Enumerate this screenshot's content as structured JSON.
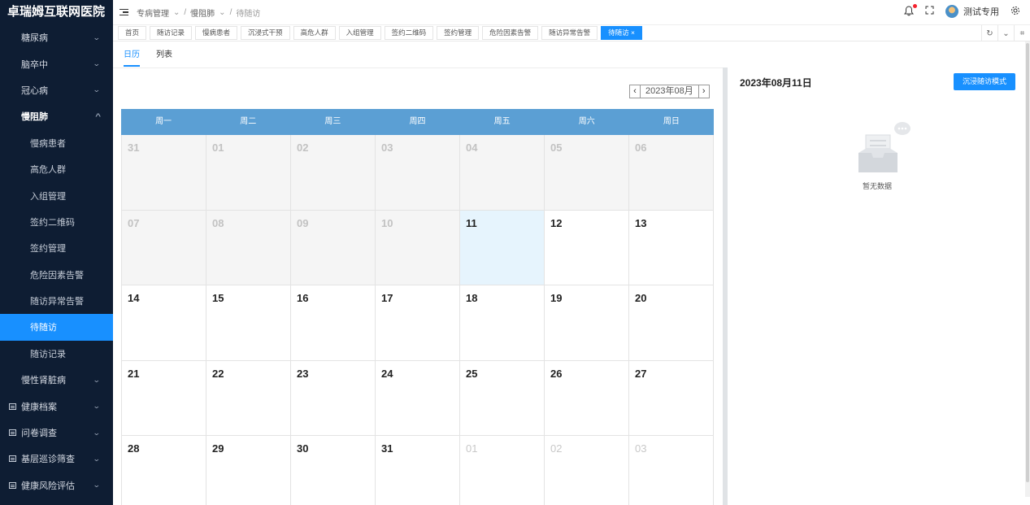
{
  "app": {
    "title": "卓瑞姆互联网医院"
  },
  "sidebar": {
    "items": [
      {
        "label": "糖尿病",
        "type": "parent"
      },
      {
        "label": "脑卒中",
        "type": "parent"
      },
      {
        "label": "冠心病",
        "type": "parent"
      },
      {
        "label": "慢阻肺",
        "type": "parent-open"
      },
      {
        "label": "慢病患者",
        "type": "sub"
      },
      {
        "label": "高危人群",
        "type": "sub"
      },
      {
        "label": "入组管理",
        "type": "sub"
      },
      {
        "label": "签约二维码",
        "type": "sub"
      },
      {
        "label": "签约管理",
        "type": "sub"
      },
      {
        "label": "危险因素告警",
        "type": "sub"
      },
      {
        "label": "随访异常告警",
        "type": "sub"
      },
      {
        "label": "待随访",
        "type": "sub-selected"
      },
      {
        "label": "随访记录",
        "type": "sub"
      },
      {
        "label": "慢性肾脏病",
        "type": "parent"
      },
      {
        "label": "健康档案",
        "type": "group"
      },
      {
        "label": "问卷调查",
        "type": "group"
      },
      {
        "label": "基层巡诊筛查",
        "type": "group"
      },
      {
        "label": "健康风险评估",
        "type": "group"
      }
    ]
  },
  "header": {
    "breadcrumb": [
      "专病管理",
      "慢阻肺",
      "待随访"
    ],
    "user": "测试专用"
  },
  "tabs": [
    {
      "label": "首页"
    },
    {
      "label": "随访记录"
    },
    {
      "label": "慢病患者"
    },
    {
      "label": "沉浸式干预"
    },
    {
      "label": "高危人群"
    },
    {
      "label": "入组管理"
    },
    {
      "label": "签约二维码"
    },
    {
      "label": "签约管理"
    },
    {
      "label": "危险因素告警"
    },
    {
      "label": "随访异常告警"
    },
    {
      "label": "待随访 ×",
      "active": true
    }
  ],
  "subtabs": {
    "calendar": "日历",
    "list": "列表"
  },
  "calendar": {
    "month_label": "2023年08月",
    "weekdays": [
      "周一",
      "周二",
      "周三",
      "周四",
      "周五",
      "周六",
      "周日"
    ],
    "weeks": [
      [
        {
          "d": "31",
          "s": "other"
        },
        {
          "d": "01",
          "s": "other"
        },
        {
          "d": "02",
          "s": "other"
        },
        {
          "d": "03",
          "s": "other"
        },
        {
          "d": "04",
          "s": "other"
        },
        {
          "d": "05",
          "s": "other"
        },
        {
          "d": "06",
          "s": "other"
        }
      ],
      [
        {
          "d": "07",
          "s": "other"
        },
        {
          "d": "08",
          "s": "other"
        },
        {
          "d": "09",
          "s": "other"
        },
        {
          "d": "10",
          "s": "other"
        },
        {
          "d": "11",
          "s": "today"
        },
        {
          "d": "12",
          "s": ""
        },
        {
          "d": "13",
          "s": ""
        }
      ],
      [
        {
          "d": "14",
          "s": ""
        },
        {
          "d": "15",
          "s": ""
        },
        {
          "d": "16",
          "s": ""
        },
        {
          "d": "17",
          "s": ""
        },
        {
          "d": "18",
          "s": ""
        },
        {
          "d": "19",
          "s": ""
        },
        {
          "d": "20",
          "s": ""
        }
      ],
      [
        {
          "d": "21",
          "s": ""
        },
        {
          "d": "22",
          "s": ""
        },
        {
          "d": "23",
          "s": ""
        },
        {
          "d": "24",
          "s": ""
        },
        {
          "d": "25",
          "s": ""
        },
        {
          "d": "26",
          "s": ""
        },
        {
          "d": "27",
          "s": ""
        }
      ],
      [
        {
          "d": "28",
          "s": ""
        },
        {
          "d": "29",
          "s": ""
        },
        {
          "d": "30",
          "s": ""
        },
        {
          "d": "31",
          "s": ""
        },
        {
          "d": "01",
          "s": "other-next"
        },
        {
          "d": "02",
          "s": "other-next"
        },
        {
          "d": "03",
          "s": "other-next"
        }
      ]
    ]
  },
  "detail": {
    "date": "2023年08月11日",
    "immersive_button": "沉浸随访模式",
    "empty_text": "暂无数据"
  },
  "colors": {
    "accent": "#1890ff",
    "sidebar_bg": "#0e1d33",
    "calendar_header": "#5b9fd4",
    "today_bg": "#e6f4fd"
  }
}
